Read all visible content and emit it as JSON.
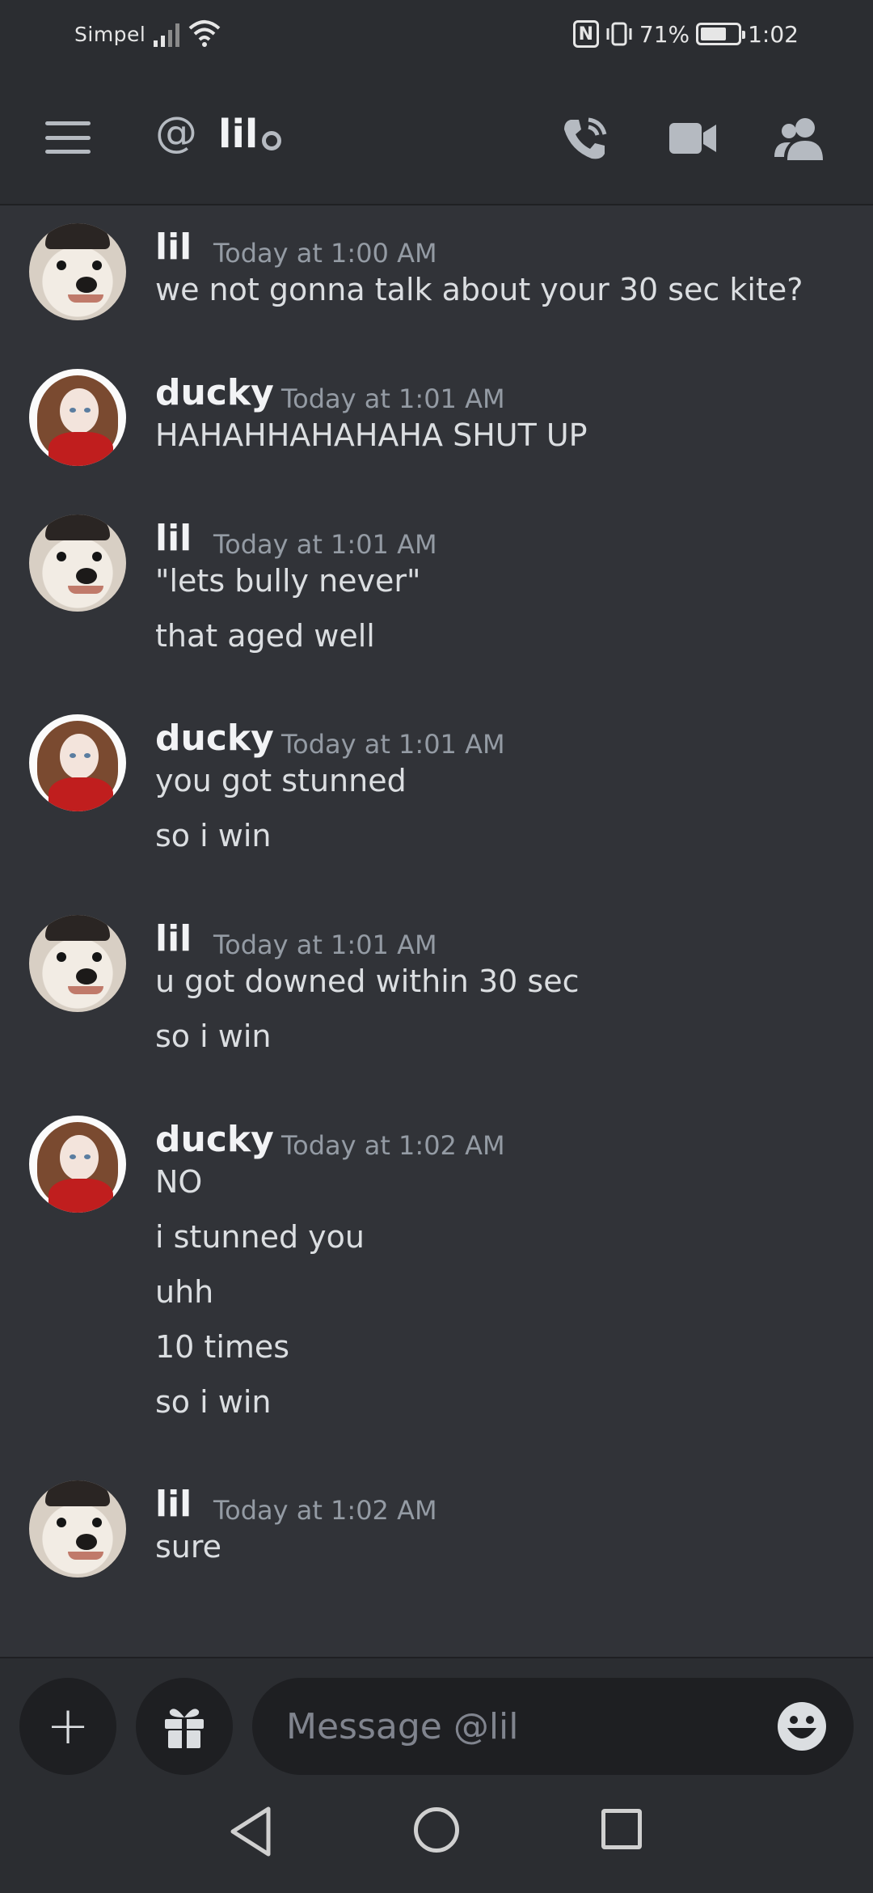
{
  "status_bar": {
    "carrier": "Simpel",
    "battery_percent": "71%",
    "battery_level": 0.71,
    "time": "1:02"
  },
  "header": {
    "at_symbol": "@",
    "channel_name": "lil",
    "icons": [
      "menu-icon",
      "voice-call-icon",
      "video-call-icon",
      "members-icon"
    ]
  },
  "messages": [
    {
      "author": "lil",
      "avatar": "dog-avatar",
      "time": "Today at 1:00 AM",
      "lines": [
        "we not gonna talk about your 30 sec kite?"
      ]
    },
    {
      "author": "ducky",
      "avatar": "anime-girl-avatar",
      "time": "Today at 1:01 AM",
      "lines": [
        "HAHAHHAHAHAHA SHUT UP"
      ]
    },
    {
      "author": "lil",
      "avatar": "dog-avatar",
      "time": "Today at 1:01 AM",
      "lines": [
        "\"lets bully never\"",
        "that aged well"
      ]
    },
    {
      "author": "ducky",
      "avatar": "anime-girl-avatar",
      "time": "Today at 1:01 AM",
      "lines": [
        "you got stunned",
        "so i win"
      ]
    },
    {
      "author": "lil",
      "avatar": "dog-avatar",
      "time": "Today at 1:01 AM",
      "lines": [
        "u got downed within 30 sec",
        "so i win"
      ]
    },
    {
      "author": "ducky",
      "avatar": "anime-girl-avatar",
      "time": "Today at 1:02 AM",
      "lines": [
        "NO",
        "i stunned you",
        "uhh",
        "10 times",
        "so i win"
      ]
    },
    {
      "author": "lil",
      "avatar": "dog-avatar",
      "time": "Today at 1:02 AM",
      "lines": [
        "sure"
      ]
    }
  ],
  "composer": {
    "placeholder": "Message @lil",
    "plus_label": "+"
  },
  "colors": {
    "background": "#313338",
    "header_bg": "#2b2d31",
    "input_bg": "#1e1f22",
    "muted_text": "#949ba4"
  }
}
